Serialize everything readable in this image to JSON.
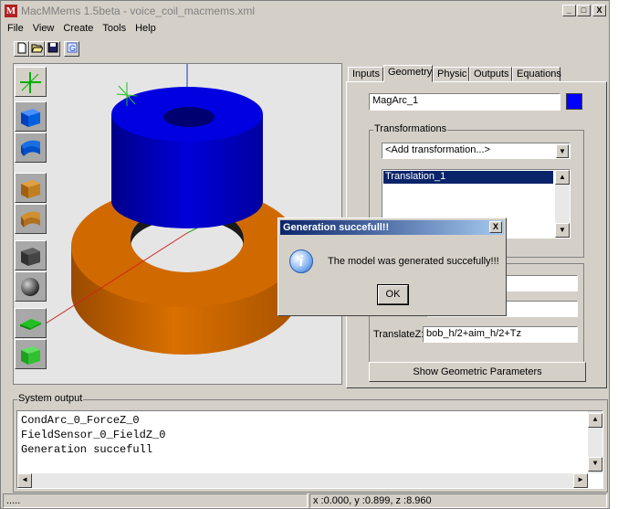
{
  "window": {
    "title": "MacMMems 1.5beta - voice_coil_macmems.xml",
    "app_icon_letter": "M",
    "controls": [
      "_",
      "□",
      "X"
    ]
  },
  "menu": [
    "File",
    "View",
    "Create",
    "Tools",
    "Help"
  ],
  "toolbar": {
    "icons": [
      "new-file-icon",
      "open-folder-icon",
      "save-icon",
      "generate-icon"
    ]
  },
  "shape_tools": [
    "axes-icon",
    "box-icon",
    "bent-box-icon",
    "arc-box-icon",
    "arc-icon",
    "cube-icon",
    "sphere-icon",
    "plate-icon",
    "wedge-icon"
  ],
  "tabs": [
    "Inputs",
    "Geometry",
    "Physic",
    "Outputs",
    "Equations"
  ],
  "active_tab": "Geometry",
  "geometry": {
    "name_value": "MagArc_1",
    "color": "#0000ff",
    "transformations_label": "Transformations",
    "add_transformation": "<Add transformation...>",
    "transform_list": [
      "Translation_1"
    ],
    "translateZ_label": "TranslateZ:",
    "translateZ_value": "bob_h/2+aim_h/2+Tz",
    "show_params_button": "Show Geometric Parameters"
  },
  "system_output": {
    "label": "System output",
    "lines": [
      "CondArc_0_ForceZ_0",
      "FieldSensor_0_FieldZ_0",
      "Generation succefull"
    ]
  },
  "status": {
    "left": ".....",
    "coords": "x :0.000, y :0.899, z :8.960"
  },
  "dialog": {
    "title": "Generation succefull!!",
    "message": "The model was generated succefully!!!",
    "ok": "OK",
    "close": "X"
  },
  "colors": {
    "dialog_title_start": "#0a246a",
    "dialog_title_end": "#a6caf0",
    "top_cylinder": "#0000d0",
    "bottom_ring": "#d06a00",
    "selected_item": "#0a246a"
  }
}
